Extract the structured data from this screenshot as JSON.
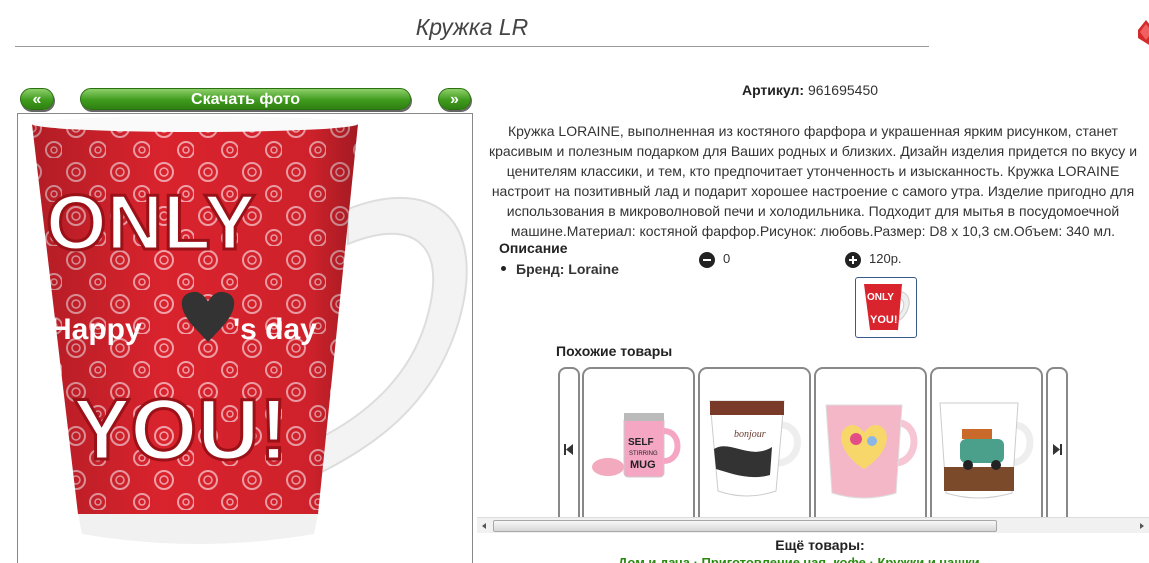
{
  "page": {
    "title": "Кружка LR"
  },
  "nav": {
    "prev_label": "«",
    "download_label": "Скачать фото",
    "next_label": "»"
  },
  "photo": {
    "text_top": "ONLY",
    "text_middle": "Happy",
    "text_middle2": "'s day",
    "text_bottom": "YOU!"
  },
  "product": {
    "sku_label": "Артикул:",
    "sku_value": "961695450",
    "description": "Кружка LORAINE, выполненная из костяного фарфора и украшенная ярким рисунком, станет красивым и полезным подарком для Ваших родных и близких. Дизайн изделия придется по вкусу и ценителям классики, и тем, кто предпочитает утонченность и изысканность. Кружка LORAINE настроит на позитивный лад и подарит хорошее настроение с самого утра. Изделие пригодно для использования в микроволновой печи и холодильника. Подходит для мытья в посудомоечной машине.Материал: костяной фарфор.Рисунок: любовь.Размер: D8 x 10,3 см.Объем: 340 мл.",
    "opisanie_label": "Описание",
    "brand_label": "Бренд: Loraine",
    "minus_value": "0",
    "plus_value": "120р."
  },
  "similar": {
    "title": "Похожие товары",
    "items": [
      {
        "name": "self-stirring-mug",
        "label": "SELF STIRRING MUG"
      },
      {
        "name": "bonjour-mug",
        "label": "bonjour"
      },
      {
        "name": "heart-flower-mug",
        "label": ""
      },
      {
        "name": "car-mug",
        "label": ""
      }
    ]
  },
  "more": {
    "title": "Ещё товары:",
    "breadcrumbs": "Дом и дача · Приготовление чая, кофе · Кружки и чашки"
  },
  "colors": {
    "accent_green": "#3f9b1d",
    "mug_red": "#d9232d",
    "close_red": "#d22"
  }
}
